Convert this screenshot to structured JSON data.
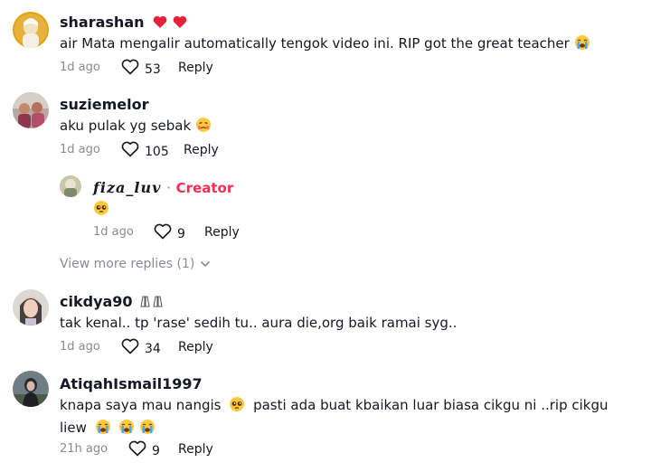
{
  "comments": [
    {
      "username": "sharashan",
      "text": "air Mata mengalir automatically tengok video ini. RIP got the great teacher",
      "time": "1d ago",
      "likes": "53",
      "reply": "Reply"
    },
    {
      "username": "suziemelor",
      "text": "aku pulak yg sebak",
      "time": "1d ago",
      "likes": "105",
      "reply": "Reply",
      "replies": [
        {
          "username": "𝒇𝒊𝒛𝒂_𝒍𝒖𝒗",
          "badge": "Creator",
          "time": "1d ago",
          "likes": "9",
          "reply": "Reply"
        }
      ],
      "view_more": "View more replies (1)"
    },
    {
      "username": "cikdya90",
      "text": "tak kenal.. tp 'rase' sedih tu.. aura die,org baik ramai syg..",
      "time": "1d ago",
      "likes": "34",
      "reply": "Reply"
    },
    {
      "username": "AtiqahIsmail1997",
      "text_a": "knapa saya mau nangis",
      "text_b": "pasti ada buat kbaikan luar biasa cikgu ni ..rip cikgu liew",
      "time": "21h ago",
      "likes": "9",
      "reply": "Reply"
    }
  ],
  "colors": {
    "creator": "#fe2c55",
    "heart": "#fe2c55",
    "muted": "#8a8b91",
    "text": "#161823"
  },
  "icons": [
    "heart-outline-icon",
    "red-heart-emoji",
    "crying-emoji",
    "pleading-emoji",
    "chevron-down-icon",
    "folded-hands-emoji"
  ]
}
